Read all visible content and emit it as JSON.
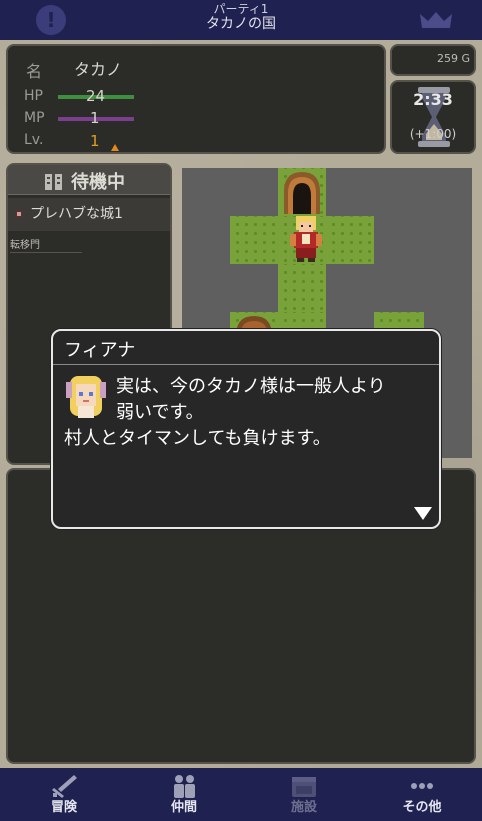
{
  "header": {
    "party_name": "パーティ1",
    "country_name": "タカノの国",
    "alert_label": "!"
  },
  "status": {
    "name_label": "名",
    "name": "タカノ",
    "hp_label": "HP",
    "hp": "24",
    "mp_label": "MP",
    "mp": "1",
    "lv_label": "Lv.",
    "lv": "1",
    "hp_color": "#3f8f3f",
    "mp_color": "#7a3f8f"
  },
  "gold": "259 G",
  "timer": {
    "time": "2:33",
    "bonus": "(+1:00)"
  },
  "location": {
    "title": "待機中",
    "place": "プレハブな城1",
    "action": "転移門"
  },
  "dialog": {
    "speaker": "フィアナ",
    "line1": "実は、今のタカノ様は一般人より",
    "line2": "弱いです。",
    "line3": "村人とタイマンしても負けます。"
  },
  "tabs": [
    {
      "label": "冒険",
      "icon": "sword-icon",
      "enabled": true
    },
    {
      "label": "仲間",
      "icon": "party-icon",
      "enabled": true
    },
    {
      "label": "施設",
      "icon": "facility-icon",
      "enabled": false
    },
    {
      "label": "その他",
      "icon": "more-icon",
      "enabled": true
    }
  ]
}
